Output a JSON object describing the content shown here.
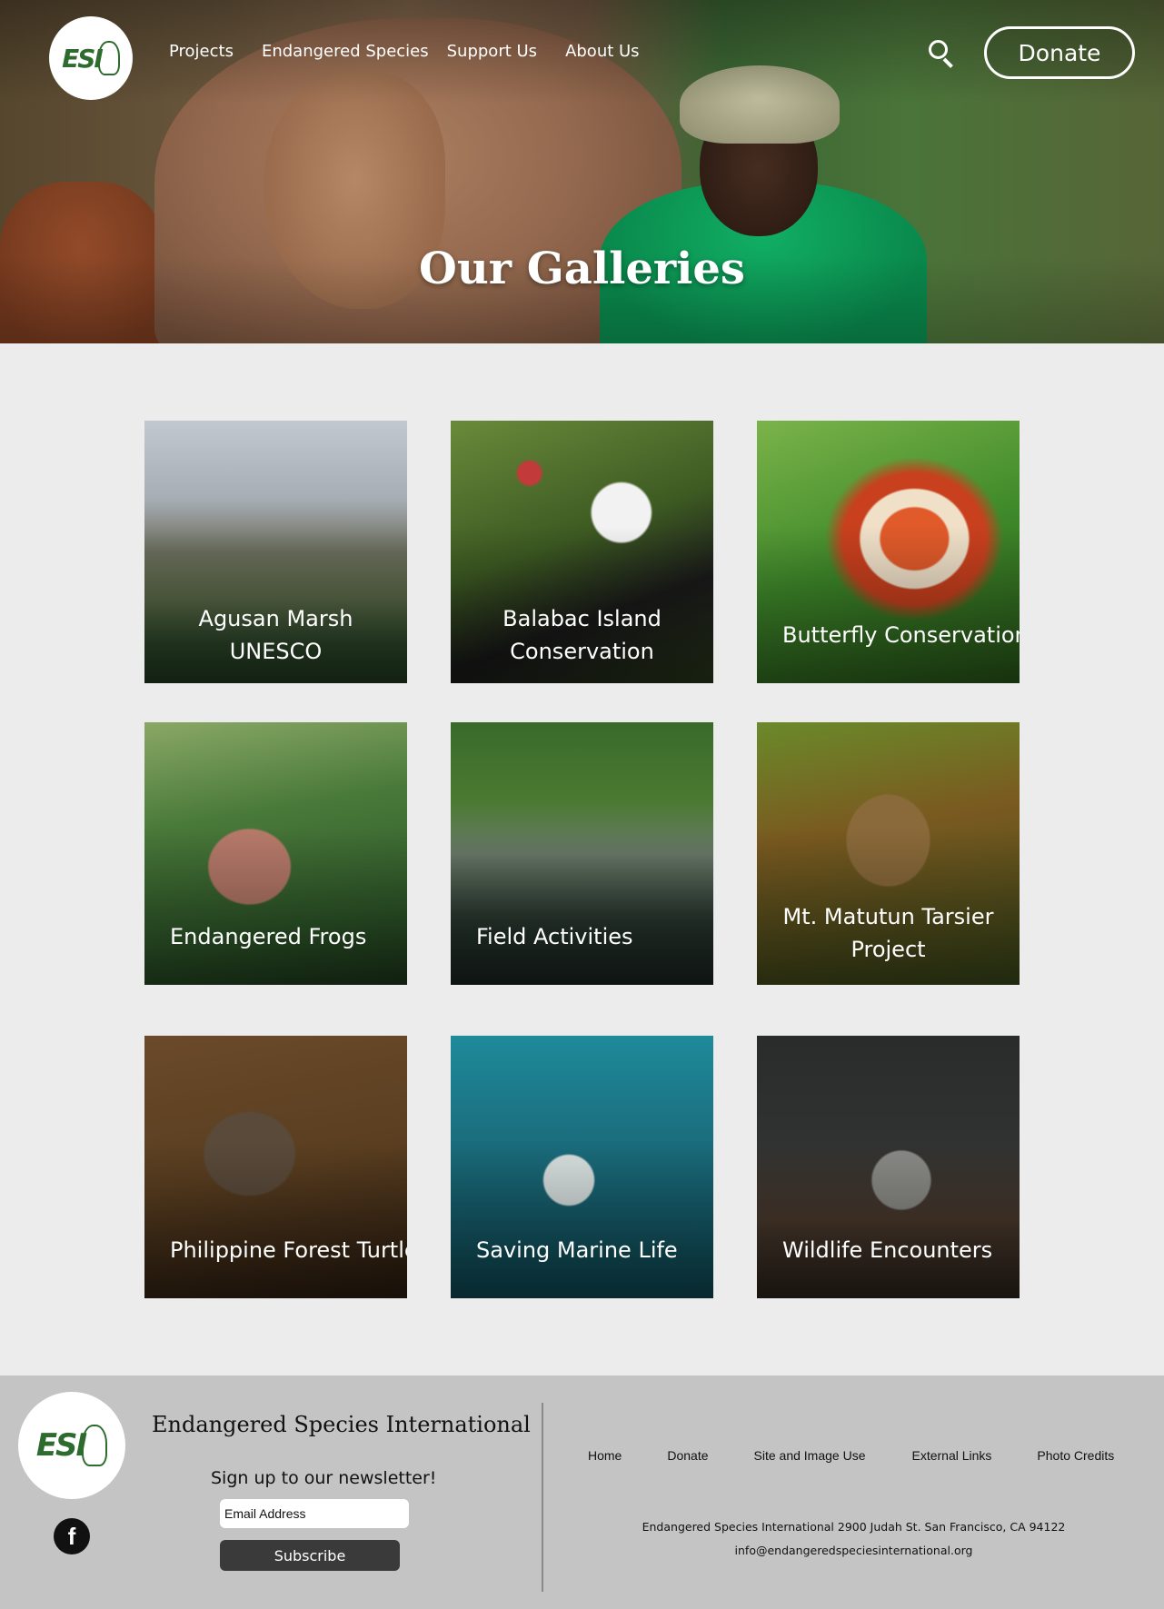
{
  "header": {
    "logo_text": "ESI",
    "nav": [
      "Projects",
      "Endangered Species",
      "Support Us",
      "About Us"
    ],
    "search_icon": "search-icon",
    "donate_label": "Donate"
  },
  "hero": {
    "title": "Our Galleries"
  },
  "galleries": [
    {
      "label": "Agusan Marsh\nUNESCO"
    },
    {
      "label": "Balabac Island\nConservation"
    },
    {
      "label": "Butterfly Conservation"
    },
    {
      "label": "Endangered Frogs"
    },
    {
      "label": "Field Activities"
    },
    {
      "label": "Mt. Matutun Tarsier\nProject"
    },
    {
      "label": "Philippine Forest Turtle"
    },
    {
      "label": "Saving Marine Life"
    },
    {
      "label": "Wildlife Encounters"
    }
  ],
  "footer": {
    "logo_text": "ESI",
    "org_name": "Endangered Species International",
    "newsletter_label": "Sign up to our newsletter!",
    "email_placeholder": "Email Address",
    "subscribe_label": "Subscribe",
    "facebook_glyph": "f",
    "links": [
      "Home",
      "Donate",
      "Site and Image Use",
      "External Links",
      "Photo Credits"
    ],
    "address": "Endangered Species International 2900 Judah St. San Francisco, CA 94122",
    "email": "info@endangeredspeciesinternational.org"
  },
  "colors": {
    "brand_green": "#2e6b2f",
    "gallery_bg": "#ececec",
    "footer_bg": "#c4c4c4",
    "subscribe_bg": "#3a3a3a"
  }
}
